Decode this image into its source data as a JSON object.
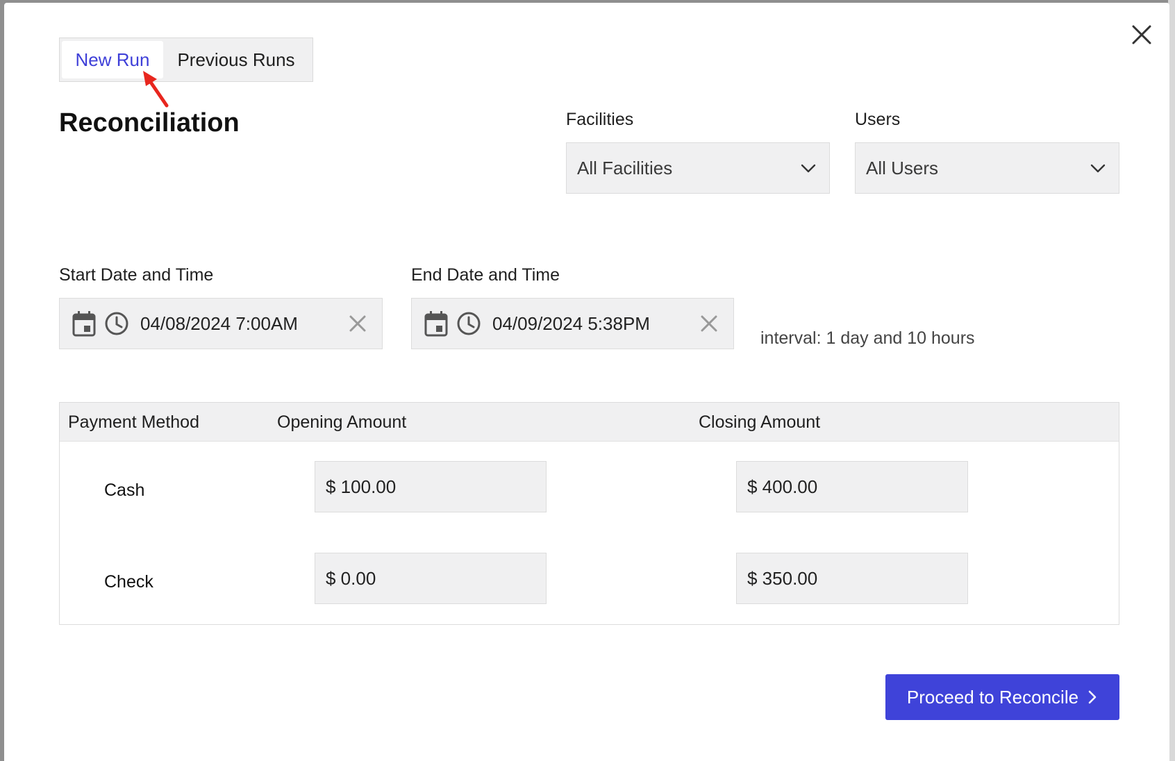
{
  "tabs": [
    {
      "label": "New Run",
      "active": true
    },
    {
      "label": "Previous Runs",
      "active": false
    }
  ],
  "page_title": "Reconciliation",
  "facilities": {
    "label": "Facilities",
    "value": "All Facilities"
  },
  "users": {
    "label": "Users",
    "value": "All Users"
  },
  "start": {
    "label": "Start Date and Time",
    "value": "04/08/2024 7:00AM"
  },
  "end": {
    "label": "End Date and Time",
    "value": "04/09/2024 5:38PM"
  },
  "interval_text": "interval: 1 day and 10 hours",
  "table": {
    "headers": [
      "Payment Method",
      "Opening Amount",
      "Closing Amount"
    ],
    "rows": [
      {
        "method": "Cash",
        "opening": "$ 100.00",
        "closing": "$ 400.00"
      },
      {
        "method": "Check",
        "opening": "$ 0.00",
        "closing": "$ 350.00"
      }
    ]
  },
  "proceed_label": "Proceed to Reconcile",
  "colors": {
    "accent": "#3f43d9",
    "annotation_arrow": "#e8261e"
  },
  "icons": [
    "close-icon",
    "chevron-down-icon",
    "calendar-icon",
    "clock-icon",
    "clear-icon",
    "chevron-right-icon",
    "annotation-arrow"
  ]
}
